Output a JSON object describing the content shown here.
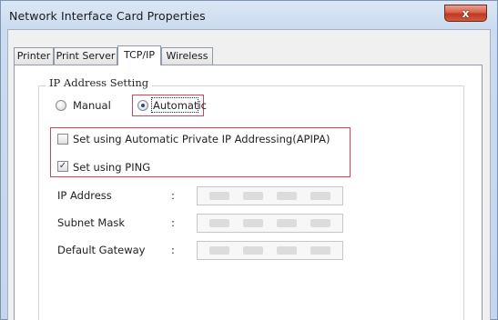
{
  "window": {
    "title": "Network Interface Card Properties",
    "close_glyph": "x"
  },
  "tabs": [
    {
      "label": "Printer"
    },
    {
      "label": "Print Server"
    },
    {
      "label": "TCP/IP",
      "active": true
    },
    {
      "label": "Wireless"
    }
  ],
  "ip_setting": {
    "legend": "IP Address Setting",
    "manual_label": "Manual",
    "automatic_label": "Automatic",
    "selected": "Automatic",
    "apipa_label": "Set using Automatic Private IP Addressing(APIPA)",
    "apipa_checked": false,
    "ping_label": "Set using PING",
    "ping_checked": true,
    "check_glyph": "✓"
  },
  "fields": [
    {
      "label": "IP Address",
      "colon": ":"
    },
    {
      "label": "Subnet Mask",
      "colon": ":"
    },
    {
      "label": "Default Gateway",
      "colon": ":"
    }
  ],
  "colors": {
    "highlight": "#d0465a",
    "close": "#c1391f"
  }
}
